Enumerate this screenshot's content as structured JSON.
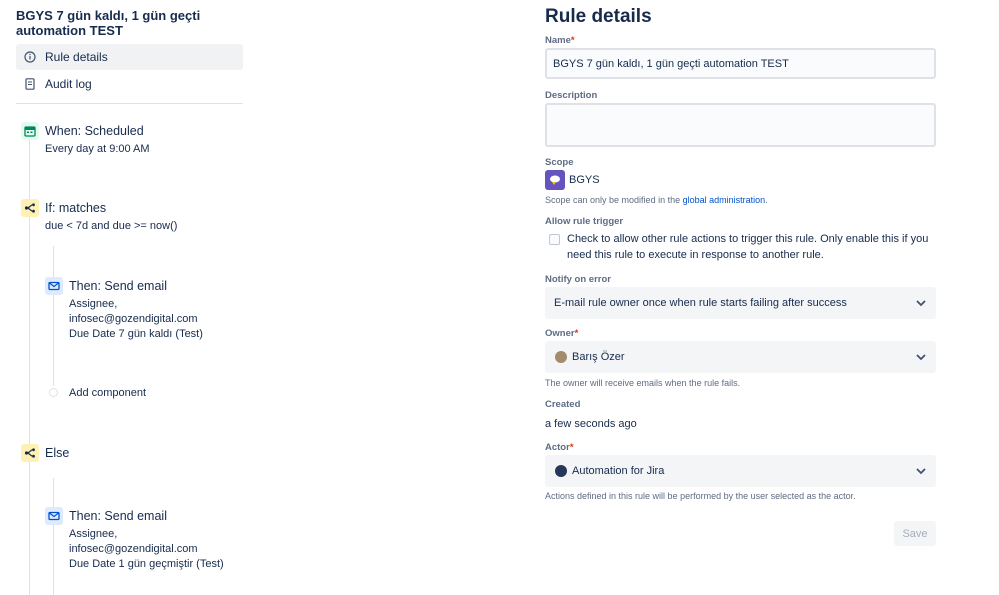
{
  "rule": {
    "title": "BGYS 7 gün kaldı, 1 gün geçti automation TEST"
  },
  "nav": {
    "rule_details": "Rule details",
    "audit_log": "Audit log"
  },
  "components": {
    "trigger": {
      "title": "When: Scheduled",
      "detail": "Every day at 9:00 AM",
      "icon": "calendar-icon"
    },
    "condition": {
      "title": "If: matches",
      "detail": "due < 7d and due >= now()",
      "icon": "branch-icon"
    },
    "action1": {
      "title": "Then: Send email",
      "lines": [
        "Assignee,",
        "infosec@gozendigital.com",
        "Due Date 7 gün kaldı (Test)"
      ],
      "icon": "mail-icon"
    },
    "add_component": "Add component",
    "else": {
      "title": "Else",
      "icon": "branch-icon"
    },
    "action2": {
      "title": "Then: Send email",
      "lines": [
        "Assignee,",
        "infosec@gozendigital.com",
        "Due Date 1 gün geçmiştir (Test)"
      ],
      "icon": "mail-icon"
    }
  },
  "details": {
    "heading": "Rule details",
    "name_label": "Name",
    "name_value": "BGYS 7 gün kaldı, 1 gün geçti automation TEST",
    "required_mark": "*",
    "description_label": "Description",
    "description_value": "",
    "scope_label": "Scope",
    "scope_value": "BGYS",
    "scope_help_prefix": "Scope can only be modified in the ",
    "scope_help_link": "global administration",
    "scope_help_suffix": ".",
    "allow_trigger_label": "Allow rule trigger",
    "allow_trigger_text": "Check to allow other rule actions to trigger this rule. Only enable this if you need this rule to execute in response to another rule.",
    "allow_trigger_checked": false,
    "notify_label": "Notify on error",
    "notify_value": "E-mail rule owner once when rule starts failing after success",
    "owner_label": "Owner",
    "owner_value": "Barış Özer",
    "owner_help": "The owner will receive emails when the rule fails.",
    "created_label": "Created",
    "created_value": "a few seconds ago",
    "actor_label": "Actor",
    "actor_value": "Automation for Jira",
    "actor_help": "Actions defined in this rule will be performed by the user selected as the actor.",
    "save_label": "Save"
  },
  "colors": {
    "accent": "#0052cc",
    "required": "#de350b",
    "trigger_bg": "#e3fcef",
    "condition_bg": "#fff0b3",
    "action_bg": "#deebff"
  }
}
